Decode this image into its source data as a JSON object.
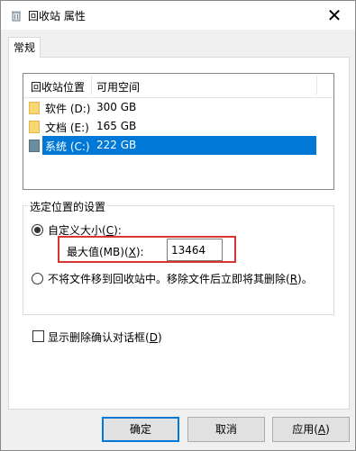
{
  "window": {
    "title": "回收站 属性",
    "title_icon": "recycle-bin-icon",
    "close_glyph": "✕"
  },
  "tabs": [
    {
      "label": "常规"
    }
  ],
  "listview": {
    "columns": [
      "回收站位置",
      "可用空间"
    ],
    "rows": [
      {
        "name": "软件 (D:)",
        "space": "300 GB",
        "selected": false
      },
      {
        "name": "文档 (E:)",
        "space": "165 GB",
        "selected": false
      },
      {
        "name": "系统 (C:)",
        "space": "222 GB",
        "selected": true
      }
    ]
  },
  "settings": {
    "group_title": "选定位置的设置",
    "custom_size": {
      "pre": "自定义大小(",
      "key": "C",
      "post": "):",
      "checked": true
    },
    "max_size": {
      "pre": "最大值(MB)(",
      "key": "X",
      "post": "):",
      "value": "13464"
    },
    "delete_immediately": {
      "pre": "不将文件移到回收站中。移除文件后立即将其删除(",
      "key": "R",
      "post": ")。",
      "checked": false
    }
  },
  "confirm_dialog": {
    "pre": "显示删除确认对话框(",
    "key": "D",
    "post": ")",
    "checked": false
  },
  "buttons": {
    "ok": "确定",
    "cancel": "取消",
    "apply": {
      "pre": "应用(",
      "key": "A",
      "post": ")"
    }
  },
  "colors": {
    "accent": "#0078d7",
    "highlight_border": "#d83535"
  }
}
